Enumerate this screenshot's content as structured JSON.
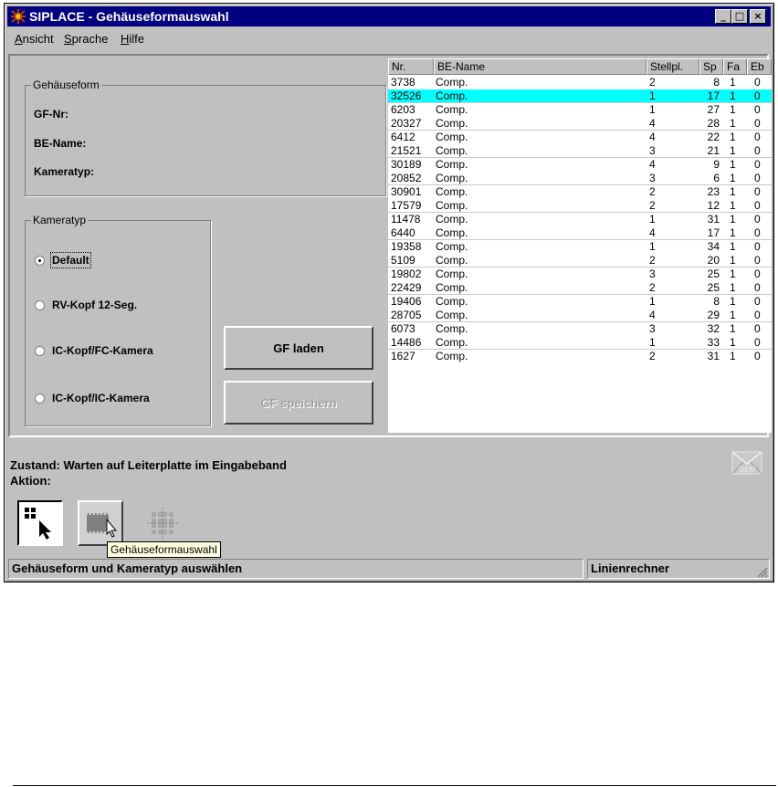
{
  "window": {
    "title": "SIPLACE - Gehäuseformauswahl",
    "controls": [
      "_",
      "□",
      "×"
    ]
  },
  "menu": [
    {
      "label": "Ansicht",
      "mnemonic": "A",
      "rest": "nsicht"
    },
    {
      "label": "Sprache",
      "mnemonic": "S",
      "rest": "prache"
    },
    {
      "label": "Hilfe",
      "mnemonic": "H",
      "rest": "ilfe"
    }
  ],
  "gehaeuseform": {
    "legend": "Gehäuseform",
    "gf_nr_label": "GF-Nr:",
    "be_name_label": "BE-Name:",
    "kameratyp_label": "Kameratyp:"
  },
  "kameratyp": {
    "legend": "Kameratyp",
    "options": [
      {
        "label": "Default",
        "checked": true
      },
      {
        "label": "RV-Kopf 12-Seg.",
        "checked": false
      },
      {
        "label": "IC-Kopf/FC-Kamera",
        "checked": false
      },
      {
        "label": "IC-Kopf/IC-Kamera",
        "checked": false
      }
    ]
  },
  "buttons": {
    "gf_laden": "GF laden",
    "gf_speichern": "GF speichern"
  },
  "table": {
    "columns": [
      "Nr.",
      "BE-Name",
      "Stellpl.",
      "Sp",
      "Fa",
      "Eb"
    ],
    "selected_index": 1,
    "rows": [
      [
        "3738",
        "Comp.",
        "2",
        "8",
        "1",
        "0"
      ],
      [
        "32526",
        "Comp.",
        "1",
        "17",
        "1",
        "0"
      ],
      [
        "6203",
        "Comp.",
        "1",
        "27",
        "1",
        "0"
      ],
      [
        "20327",
        "Comp.",
        "4",
        "28",
        "1",
        "0"
      ],
      [
        "6412",
        "Comp.",
        "4",
        "22",
        "1",
        "0"
      ],
      [
        "21521",
        "Comp.",
        "3",
        "21",
        "1",
        "0"
      ],
      [
        "30189",
        "Comp.",
        "4",
        "9",
        "1",
        "0"
      ],
      [
        "20852",
        "Comp.",
        "3",
        "6",
        "1",
        "0"
      ],
      [
        "30901",
        "Comp.",
        "2",
        "23",
        "1",
        "0"
      ],
      [
        "17579",
        "Comp.",
        "2",
        "12",
        "1",
        "0"
      ],
      [
        "11478",
        "Comp.",
        "1",
        "31",
        "1",
        "0"
      ],
      [
        "6440",
        "Comp.",
        "4",
        "17",
        "1",
        "0"
      ],
      [
        "19358",
        "Comp.",
        "1",
        "34",
        "1",
        "0"
      ],
      [
        "5109",
        "Comp.",
        "2",
        "20",
        "1",
        "0"
      ],
      [
        "19802",
        "Comp.",
        "3",
        "25",
        "1",
        "0"
      ],
      [
        "22429",
        "Comp.",
        "2",
        "25",
        "1",
        "0"
      ],
      [
        "19406",
        "Comp.",
        "1",
        "8",
        "1",
        "0"
      ],
      [
        "28705",
        "Comp.",
        "4",
        "29",
        "1",
        "0"
      ],
      [
        "6073",
        "Comp.",
        "3",
        "32",
        "1",
        "0"
      ],
      [
        "14486",
        "Comp.",
        "1",
        "33",
        "1",
        "0"
      ],
      [
        "1627",
        "Comp.",
        "2",
        "31",
        "1",
        "0"
      ]
    ]
  },
  "status": {
    "zustand": "Zustand: Warten auf Leiterplatte im Eingabeband",
    "aktion": "Aktion:",
    "gem_label": "GEM"
  },
  "toolbar": {
    "tooltip": "Gehäuseformauswahl"
  },
  "statusbar": {
    "message": "Gehäuseform und Kameratyp auswählen",
    "computer": "Linienrechner"
  },
  "colors": {
    "titlebar": "#000080",
    "face": "#c0c0c0",
    "selection": "#00ffff",
    "tooltip": "#ffffe1"
  }
}
